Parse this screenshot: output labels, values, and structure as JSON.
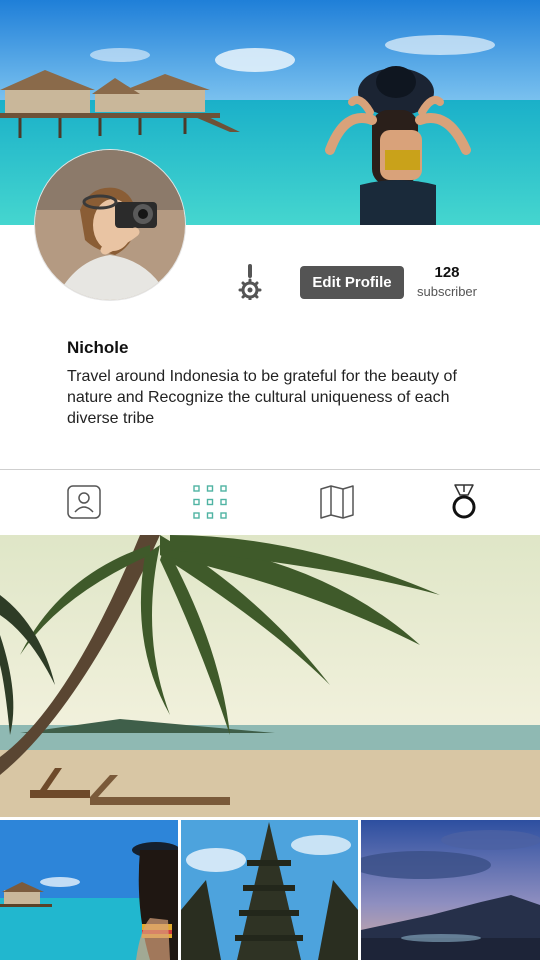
{
  "profile": {
    "name": "Nichole",
    "bio": "Travel around Indonesia to be grateful for the beauty of nature and Recognize the cultural uniqueness of each diverse tribe",
    "edit_label": "Edit Profile",
    "subscriber_count": "128",
    "subscriber_label": "subscriber"
  },
  "tabs": [
    {
      "icon": "profile-icon"
    },
    {
      "icon": "grid-icon",
      "active_color": "#4fb3a3"
    },
    {
      "icon": "map-icon"
    },
    {
      "icon": "medal-icon"
    }
  ],
  "colors": {
    "edit_button": "#545454",
    "divider": "#cfcfcf"
  }
}
